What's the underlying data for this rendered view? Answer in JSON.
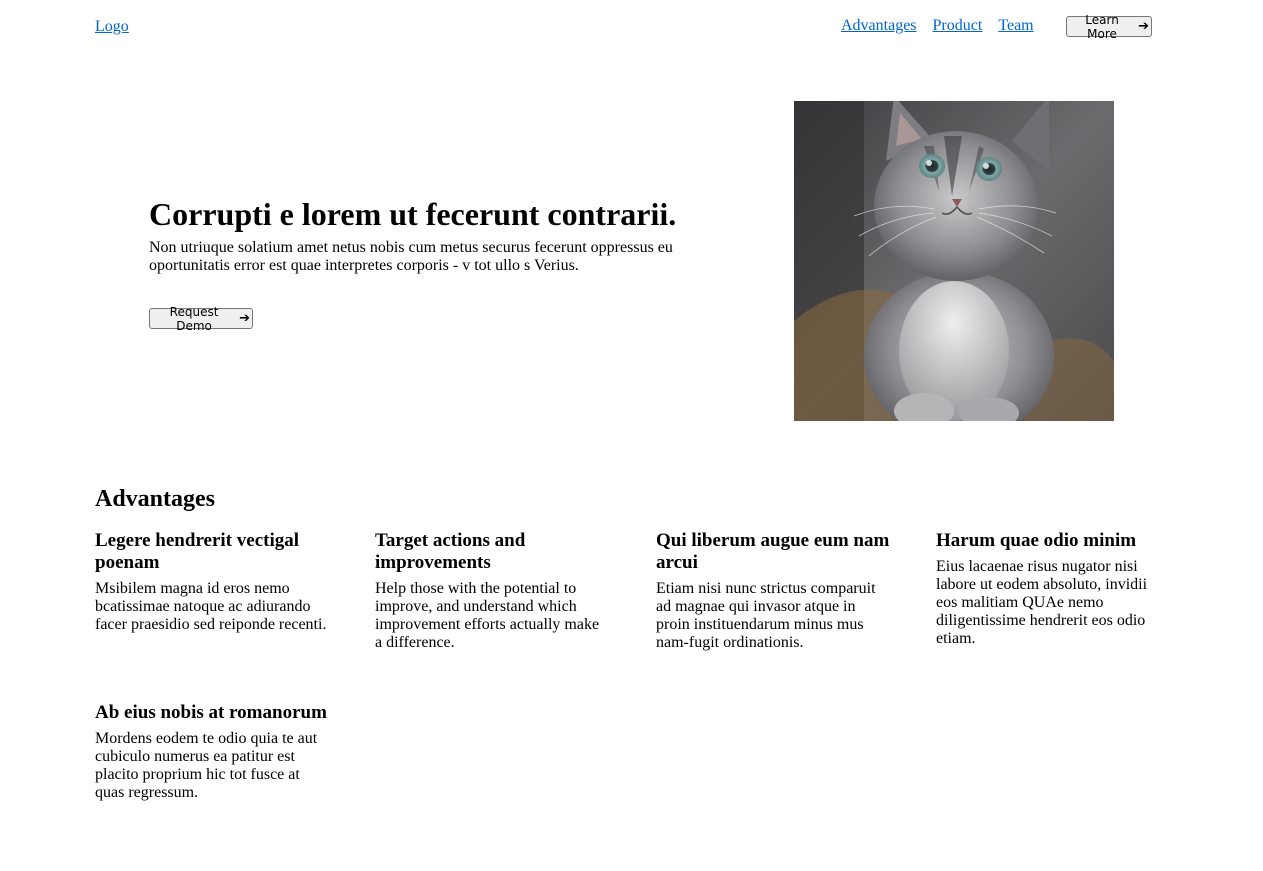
{
  "header": {
    "logo": "Logo",
    "nav": [
      "Advantages",
      "Product",
      "Team"
    ],
    "cta_label": "Learn More",
    "cta_icon": "arrow-right-icon"
  },
  "hero": {
    "title": "Corrupti e lorem ut fecerunt contrarii.",
    "subtitle": "Non utriuque solatium amet netus nobis cum metus securus fecerunt oppressus eu oportunitatis error est quae interpretes corporis - v tot ullo s Verius.",
    "button_label": "Request Demo",
    "button_icon": "arrow-right-icon",
    "image": "kitten-photo"
  },
  "advantages": {
    "heading": "Advantages",
    "items": [
      {
        "title": "Legere hendrerit vectigal poenam",
        "text": "Msibilem magna id eros nemo bcatissimae natoque ac adiurando facer praesidio sed reiponde recenti."
      },
      {
        "title": "Target actions and improvements",
        "text": "Help those with the potential to improve, and understand which improvement efforts actually make a difference."
      },
      {
        "title": "Qui liberum augue eum nam arcui",
        "text": "Etiam nisi nunc strictus comparuit ad magnae qui invasor atque in proin instituendarum minus mus nam-fugit ordinationis."
      },
      {
        "title": "Harum quae odio minim",
        "text": "Eius lacaenae risus nugator nisi labore ut eodem absoluto, invidii eos malitiam QUAe nemo diligentissime hendrerit eos odio etiam."
      },
      {
        "title": "Ab eius nobis at romanorum",
        "text": "Mordens eodem te odio quia te aut cubiculo numerus ea patitur est placito proprium hic tot fusce at quas regressum."
      }
    ]
  },
  "colors": {
    "link": "#0066cc",
    "button_bg": "#efefef",
    "button_border": "#767676"
  }
}
